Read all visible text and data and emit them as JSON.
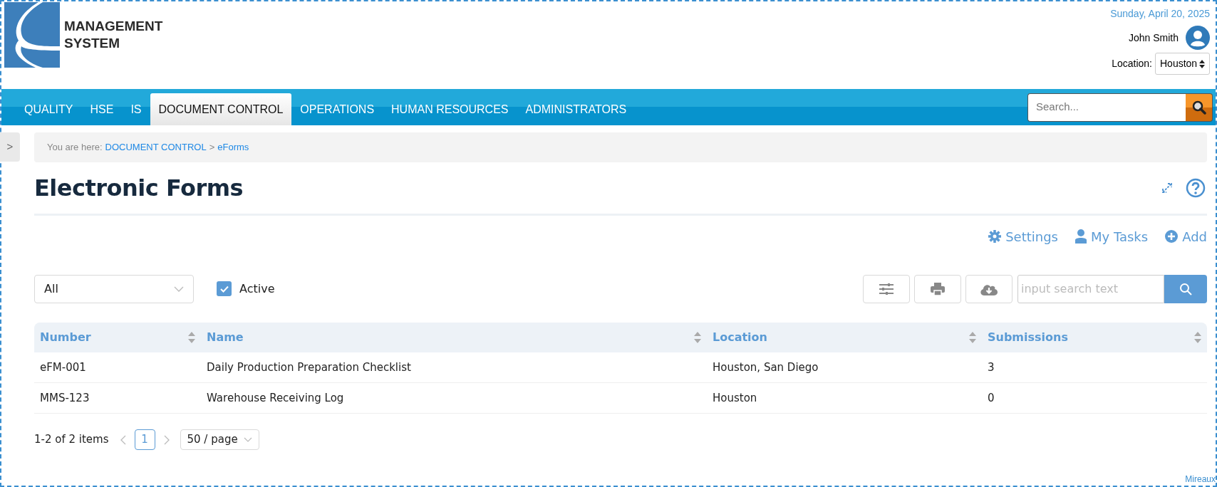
{
  "header": {
    "logo_text": [
      "MANAGEMENT",
      "SYSTEM"
    ],
    "date": "Sunday, April 20, 2025",
    "user": "John Smith",
    "location_label": "Location:",
    "location_value": "Houston"
  },
  "nav": {
    "items": [
      {
        "label": "QUALITY",
        "selected": false
      },
      {
        "label": "HSE",
        "selected": false
      },
      {
        "label": "IS",
        "selected": false
      },
      {
        "label": "DOCUMENT CONTROL",
        "selected": true
      },
      {
        "label": "OPERATIONS",
        "selected": false
      },
      {
        "label": "HUMAN RESOURCES",
        "selected": false
      },
      {
        "label": "ADMINISTRATORS",
        "selected": false
      }
    ],
    "search_placeholder": "Search..."
  },
  "sidebar_toggle": ">",
  "breadcrumb": {
    "prefix": "You are here:",
    "links": [
      "DOCUMENT CONTROL",
      "eForms"
    ],
    "separator": ">"
  },
  "page_title": "Electronic Forms",
  "actions": [
    {
      "kind": "settings",
      "label": "Settings"
    },
    {
      "kind": "tasks",
      "label": "My Tasks"
    },
    {
      "kind": "add",
      "label": "Add"
    }
  ],
  "filter": {
    "select_value": "All",
    "active_label": "Active",
    "active_checked": true,
    "search_placeholder": "input search text"
  },
  "table": {
    "columns": [
      "Number",
      "Name",
      "Location",
      "Submissions"
    ],
    "rows": [
      [
        "eFM-001",
        "Daily Production Preparation Checklist",
        "Houston, San Diego",
        "3"
      ],
      [
        "MMS-123",
        "Warehouse Receiving Log",
        "Houston",
        "0"
      ]
    ]
  },
  "pagination": {
    "summary": "1-2 of 2 items",
    "pages": [
      {
        "label": "1",
        "selected": true
      }
    ],
    "page_size": "50 / page"
  },
  "footer": "Mireaux"
}
